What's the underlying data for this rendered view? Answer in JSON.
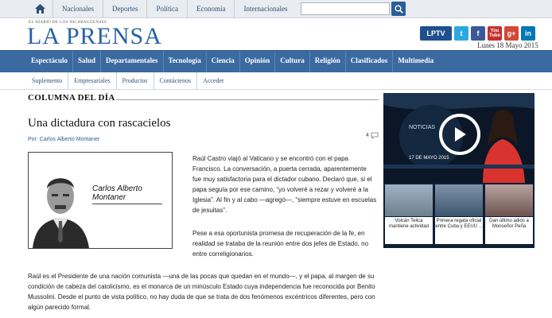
{
  "topnav": {
    "items": [
      "Nacionales",
      "Deportes",
      "Política",
      "Economía",
      "Internacionales"
    ]
  },
  "search": {
    "placeholder": ""
  },
  "header": {
    "tagline": "EL DIARIO DE LOS NICARAGÜENSES",
    "logo": "LA PRENSA",
    "date": "Lunes 18 Mayo 2015",
    "social": [
      "LPTV",
      "t",
      "f",
      "You Tube",
      "g+",
      "in"
    ]
  },
  "mainnav": {
    "items": [
      "Espectáculo",
      "Salud",
      "Departamentales",
      "Tecnología",
      "Ciencia",
      "Opinión",
      "Cultura",
      "Religión",
      "Clasificados",
      "Multimedia"
    ]
  },
  "subnav": {
    "items": [
      "Suplemento",
      "Empresariales",
      "Productos",
      "Contáctenos",
      "Acceder"
    ]
  },
  "article": {
    "section": "COLUMNA DEL DÍA",
    "title": "Una dictadura con rascacielos",
    "byline": "Por: Carlos Alberto Montaner",
    "comment_count": "4",
    "photo_name_line1": "Carlos Alberto",
    "photo_name_line2": "Montaner",
    "p1": "Raúl Castro viajó al Vaticano y se encontró con el papa Francisco. La conversación, a puerta cerrada, aparentemente fue muy satisfactoria para el dictador cubano. Declaró que, si el papa seguía por ese camino, “yo volveré a rezar y volveré a la Iglesia”. Al fin y al cabo —agregó—, “siempre estuve en escuelas de jesuitas”.",
    "p2": "Pese a esa oportunista promesa de recuperación de la fe, en realidad se trataba de la reunión entre dos jefes de Estado, no entre correligionarios.",
    "p3": "Raúl es el Presidente de una nación comunista —una de las pocas que quedan en el mundo—, y el papa, al margen de su condición de cabeza del catolicismo, es el monarca de un minúsculo Estado cuya independencia fue reconocida por Benito Mussolini. Desde el punto de vista político, no hay duda de que se trata de dos fenómenos excéntricos diferentes, pero con algún parecido formal."
  },
  "video": {
    "label": "NOTICIAS",
    "date": "17 DE MAYO 2015"
  },
  "thumbs": [
    {
      "caption": "Volcán Telica mantiene actividad"
    },
    {
      "caption": "Primera regata oficial entre Cuba y EEUU ..."
    },
    {
      "caption": "Dan último adiós a Monseñor Peña"
    }
  ]
}
